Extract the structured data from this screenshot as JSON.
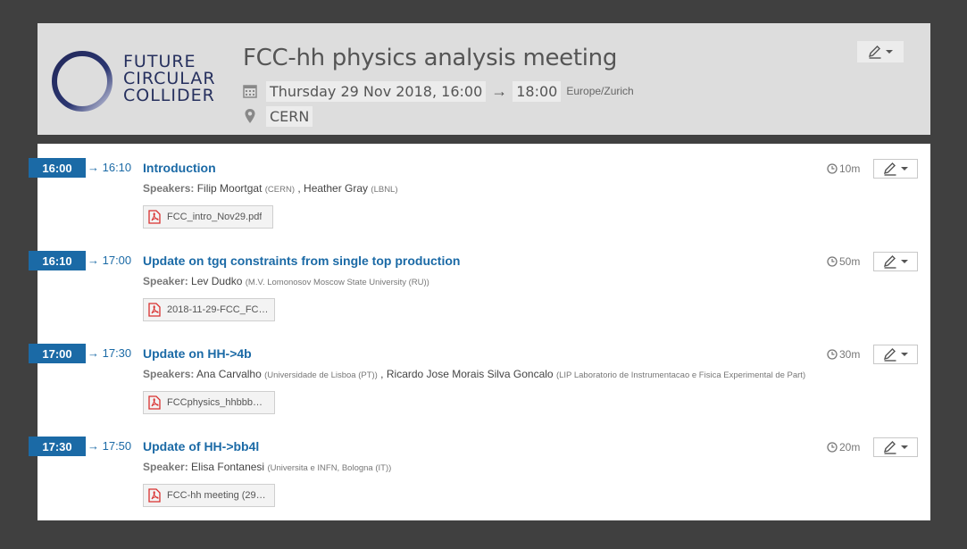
{
  "header": {
    "logo_lines": [
      "FUTURE",
      "CIRCULAR",
      "COLLIDER"
    ],
    "title": "FCC-hh physics analysis meeting",
    "date_start": "Thursday 29 Nov 2018, 16:00",
    "arrow": "→",
    "date_end": "18:00",
    "timezone": "Europe/Zurich",
    "location": "CERN",
    "icons": {
      "calendar": "calendar-icon",
      "location": "map-pin-icon",
      "edit": "pen-icon"
    }
  },
  "timetable": [
    {
      "start": "16:00",
      "end": "→ 16:10",
      "title": "Introduction",
      "speaker_label": "Speakers",
      "speakers": [
        {
          "name": "Filip Moortgat",
          "affiliation": "(CERN)"
        },
        {
          "name": "Heather Gray",
          "affiliation": "(LBNL)"
        }
      ],
      "attachment": "FCC_intro_Nov29.pdf",
      "duration": "10m"
    },
    {
      "start": "16:10",
      "end": "→ 17:00",
      "title": "Update on tgq constraints from single top production",
      "speaker_label": "Speaker",
      "speakers": [
        {
          "name": "Lev Dudko",
          "affiliation": "(M.V. Lomonosov Moscow State University (RU))"
        }
      ],
      "attachment": "2018-11-29-FCC_FC…",
      "duration": "50m"
    },
    {
      "start": "17:00",
      "end": "→ 17:30",
      "title": "Update on HH->4b",
      "speaker_label": "Speakers",
      "speakers": [
        {
          "name": "Ana Carvalho",
          "affiliation": "(Universidade de Lisboa (PT))"
        },
        {
          "name": "Ricardo Jose Morais Silva Goncalo",
          "affiliation": "(LIP Laboratorio de Instrumentacao e Fisica Experimental de Part)"
        }
      ],
      "attachment": "FCCphysics_hhbbb…",
      "duration": "30m"
    },
    {
      "start": "17:30",
      "end": "→ 17:50",
      "title": "Update of HH->bb4l",
      "speaker_label": "Speaker",
      "speakers": [
        {
          "name": "Elisa Fontanesi",
          "affiliation": "(Universita e INFN, Bologna (IT))"
        }
      ],
      "attachment": "FCC-hh meeting (29…",
      "duration": "20m"
    }
  ],
  "colors": {
    "accent": "#1b6aa6",
    "background": "#404040",
    "header_bg": "#dddddd",
    "pdf": "#d9302f"
  }
}
